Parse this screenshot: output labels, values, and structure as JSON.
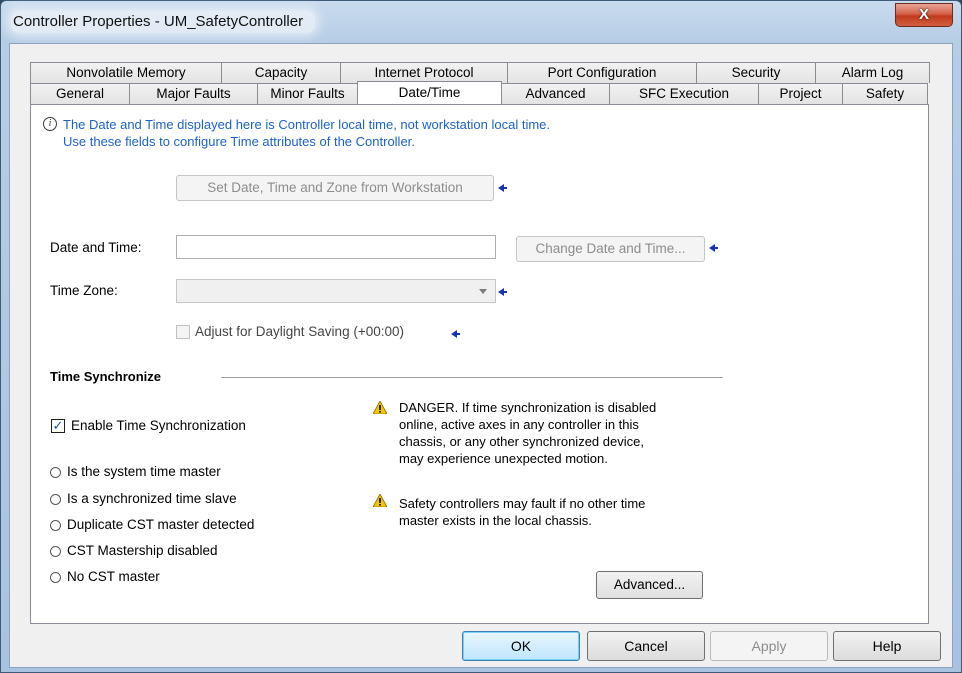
{
  "window": {
    "title": "Controller Properties - UM_SafetyController",
    "close_label": "X"
  },
  "tabs": {
    "row1": [
      "Nonvolatile Memory",
      "Capacity",
      "Internet Protocol",
      "Port Configuration",
      "Security",
      "Alarm Log"
    ],
    "row2": [
      "General",
      "Major Faults",
      "Minor Faults",
      "Date/Time",
      "Advanced",
      "SFC Execution",
      "Project",
      "Safety"
    ],
    "active": "Date/Time"
  },
  "info": {
    "line1": "The Date and Time displayed here is Controller local time, not workstation local time.",
    "line2": "Use these fields to configure Time attributes of the Controller."
  },
  "set_from_workstation_label": "Set Date, Time and Zone from Workstation",
  "date_time": {
    "label": "Date and Time:",
    "value": "",
    "change_button_label": "Change Date and Time..."
  },
  "time_zone": {
    "label": "Time Zone:",
    "value": ""
  },
  "daylight_saving_label": "Adjust for Daylight Saving (+00:00)",
  "time_sync": {
    "section_title": "Time Synchronize",
    "enable_label": "Enable Time Synchronization",
    "enable_checked": true,
    "status_options": [
      "Is the system time master",
      "Is a synchronized time slave",
      "Duplicate CST master detected",
      "CST Mastership disabled",
      "No CST master"
    ],
    "danger_lines": [
      "DANGER. If time synchronization is disabled",
      "online, active axes in any controller in this",
      "chassis, or any other synchronized device,",
      "may experience unexpected motion."
    ],
    "safety_lines": [
      "Safety controllers may fault if no other time",
      "master exists in the local chassis."
    ],
    "advanced_button_label": "Advanced..."
  },
  "footer": {
    "ok_label": "OK",
    "cancel_label": "Cancel",
    "apply_label": "Apply",
    "help_label": "Help"
  },
  "icons": {
    "info": "info-icon",
    "warning": "warning-icon",
    "arrow": "blue-arrow-icon"
  },
  "colors": {
    "info_text": "#1c62c8",
    "arrow": "#1733b8",
    "warning": "#f5c400"
  }
}
